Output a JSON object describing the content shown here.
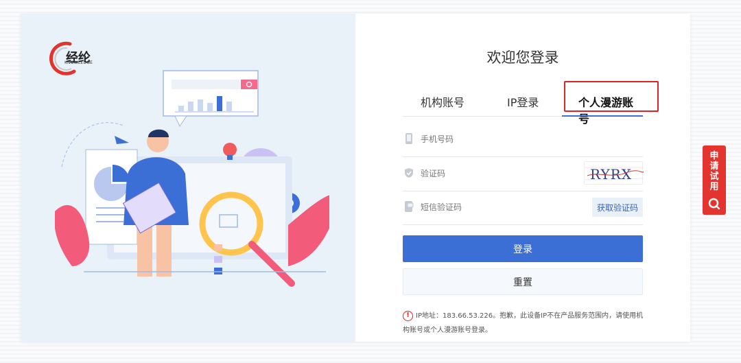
{
  "brand": {
    "name": "经纶",
    "sub": "KNOWLEDGE"
  },
  "welcome": "欢迎您登录",
  "tabs": [
    {
      "label": "机构账号"
    },
    {
      "label": "IP登录"
    },
    {
      "label": "个人漫游账号",
      "active": true
    }
  ],
  "form": {
    "phone_placeholder": "手机号码",
    "captcha_placeholder": "验证码",
    "captcha_text": "RYRX",
    "sms_placeholder": "短信验证码",
    "sms_button": "获取验证码",
    "login_button": "登录",
    "reset_button": "重置"
  },
  "notice": "IP地址：183.66.53.226。抱歉，此设备IP不在产品服务范围内，请使用机构账号或个人漫游账号登录。",
  "trial": {
    "label": "申请试用"
  },
  "colors": {
    "primary": "#3b6fd6",
    "accent": "#e3342f",
    "highlight": "#e02020"
  }
}
